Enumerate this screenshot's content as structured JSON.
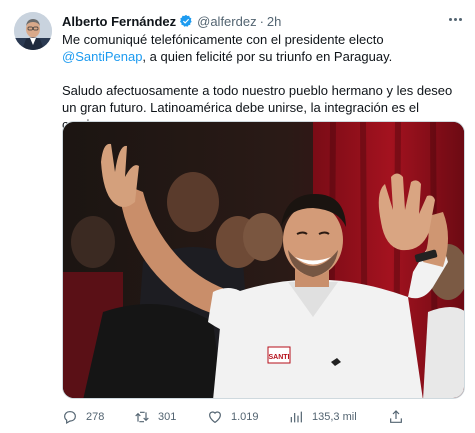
{
  "tweet": {
    "author_name": "Alberto Fernández",
    "handle": "@alferdez",
    "separator": "·",
    "time": "2h",
    "text": {
      "line1_before": "Me comuniqué telefónicamente con el presidente electo ",
      "mention": "@SantiPenap",
      "line1_after": ", a quien felicité por su triunfo en Paraguay.",
      "paragraph2": "Saludo afectuosamente a todo nuestro pueblo hermano y les deseo un gran futuro. Latinoamérica debe unirse, la integración es el camino."
    },
    "media": {
      "shirt_text": "SANTI"
    },
    "actions": {
      "replies": "278",
      "retweets": "301",
      "likes": "1.019",
      "views": "135,3 mil"
    }
  },
  "colors": {
    "accent": "#1d9bf0",
    "secondary_text": "#536471",
    "primary_text": "#0f1419"
  },
  "icons": [
    "verified-badge-icon",
    "more-icon",
    "reply-icon",
    "retweet-icon",
    "like-icon",
    "views-icon",
    "share-icon"
  ]
}
